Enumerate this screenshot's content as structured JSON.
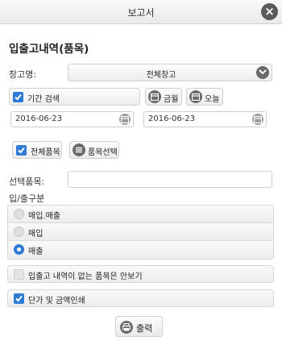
{
  "window": {
    "title": "보고서"
  },
  "heading": "입출고내역(품목)",
  "warehouse": {
    "label": "창고명:",
    "value": "전체창고"
  },
  "period": {
    "checkbox_label": "기간 검색",
    "today_month_label": "금월",
    "today_label": "오늘",
    "start_date": "2016-06-23",
    "end_date": "2016-06-23"
  },
  "items": {
    "all_items_label": "전체품목",
    "select_items_label": "품목선택",
    "selected_label": "선택품목:",
    "selected_value": ""
  },
  "inout": {
    "label": "입/출구분",
    "options": [
      "매입.매출",
      "매입",
      "매출"
    ],
    "selected": "매출"
  },
  "options": {
    "hide_no_history_label": "입출고 내역이 없는 품목은 안보기",
    "print_price_label": "단가 및 금액인쇄"
  },
  "print_label": "출력"
}
